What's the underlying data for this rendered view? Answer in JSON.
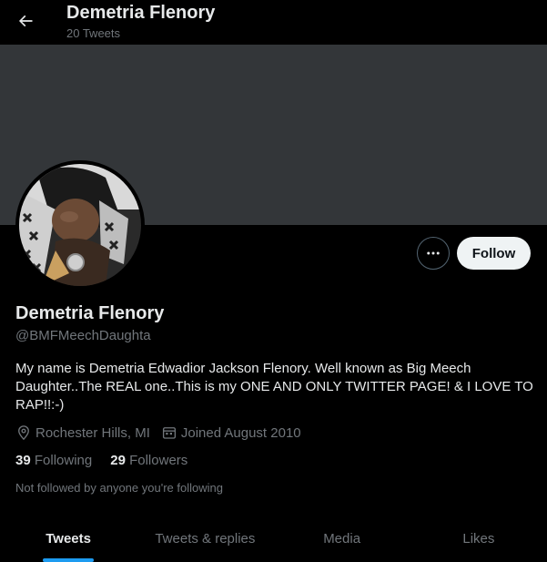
{
  "header": {
    "title": "Demetria Flenory",
    "tweet_count": "20 Tweets"
  },
  "profile": {
    "name": "Demetria Flenory",
    "handle": "@BMFMeechDaughta",
    "bio": "My name is Demetria Edwadior Jackson Flenory. Well known as Big Meech Daughter..The REAL one..This is my ONE AND ONLY TWITTER PAGE! & I LOVE TO RAP!!:-)",
    "location": "Rochester Hills, MI",
    "joined": "Joined August 2010",
    "following_count": "39",
    "following_label": "Following",
    "followers_count": "29",
    "followers_label": "Followers",
    "not_followed_text": "Not followed by anyone you're following"
  },
  "actions": {
    "follow_label": "Follow",
    "more_icon": "more-horizontal-icon"
  },
  "tabs": [
    {
      "label": "Tweets",
      "active": true
    },
    {
      "label": "Tweets & replies",
      "active": false
    },
    {
      "label": "Media",
      "active": false
    },
    {
      "label": "Likes",
      "active": false
    }
  ],
  "colors": {
    "accent": "#1d9bf0",
    "banner": "#333639",
    "background": "#000000"
  }
}
